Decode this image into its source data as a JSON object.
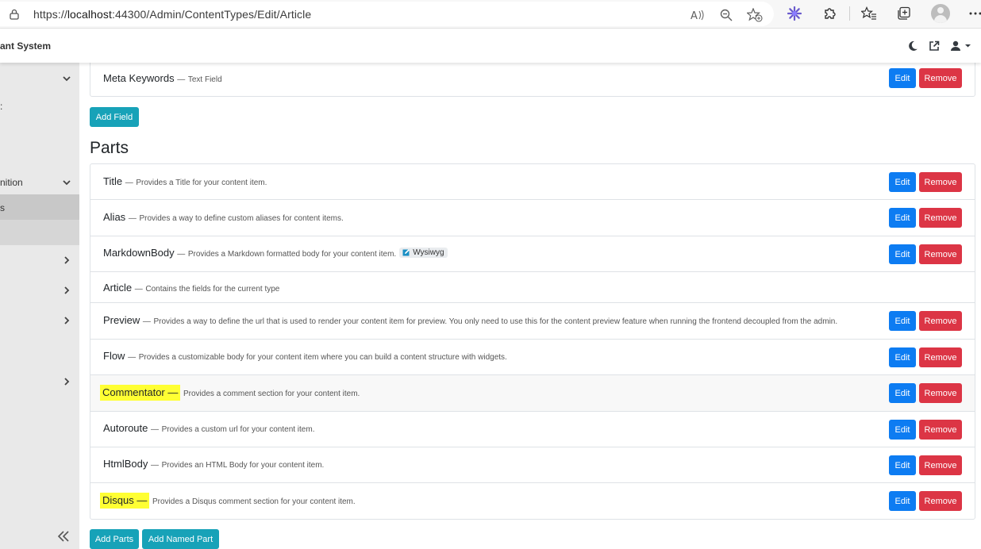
{
  "browser": {
    "url_prefix": "https://",
    "url_host": "localhost",
    "url_rest": ":44300/Admin/ContentTypes/Edit/Article"
  },
  "header": {
    "brand": "ant System"
  },
  "sidebar": {
    "items": [
      {
        "label": ""
      },
      {
        "label": ":"
      },
      {
        "label": "nition"
      },
      {
        "label": "s"
      },
      {
        "label": ""
      },
      {
        "label": ""
      },
      {
        "label": ""
      },
      {
        "label": ""
      }
    ]
  },
  "fields": {
    "rows": [
      {
        "name": "Meta Keywords",
        "desc": "Text Field",
        "edit": "Edit",
        "remove": "Remove"
      }
    ],
    "add_field_label": "Add Field"
  },
  "parts": {
    "title": "Parts",
    "rows": [
      {
        "name": "Title",
        "desc": "Provides a Title for your content item.",
        "edit": "Edit",
        "remove": "Remove"
      },
      {
        "name": "Alias",
        "desc": "Provides a way to define custom aliases for content items.",
        "edit": "Edit",
        "remove": "Remove"
      },
      {
        "name": "MarkdownBody",
        "desc": "Provides a Markdown formatted body for your content item.",
        "badge": "Wysiwyg",
        "edit": "Edit",
        "remove": "Remove"
      },
      {
        "name": "Article",
        "desc": "Contains the fields for the current type"
      },
      {
        "name": "Preview",
        "desc": "Provides a way to define the url that is used to render your content item for preview. You only need to use this for the content preview feature when running the frontend decoupled from the admin.",
        "edit": "Edit",
        "remove": "Remove"
      },
      {
        "name": "Flow",
        "desc": "Provides a customizable body for your content item where you can build a content structure with widgets.",
        "edit": "Edit",
        "remove": "Remove"
      },
      {
        "name": "Commentator",
        "desc": "Provides a comment section for your content item.",
        "edit": "Edit",
        "remove": "Remove"
      },
      {
        "name": "Autoroute",
        "desc": "Provides a custom url for your content item.",
        "edit": "Edit",
        "remove": "Remove"
      },
      {
        "name": "HtmlBody",
        "desc": "Provides an HTML Body for your content item.",
        "edit": "Edit",
        "remove": "Remove"
      },
      {
        "name": "Disqus",
        "desc": "Provides a Disqus comment section for your content item.",
        "edit": "Edit",
        "remove": "Remove"
      }
    ],
    "dash": "—",
    "add_parts_label": "Add Parts",
    "add_named_part_label": "Add Named Part"
  },
  "colors": {
    "primary": "#0d7cf2",
    "danger": "#dc3545",
    "teal": "#17a2b8",
    "highlight": "#ffff33"
  }
}
